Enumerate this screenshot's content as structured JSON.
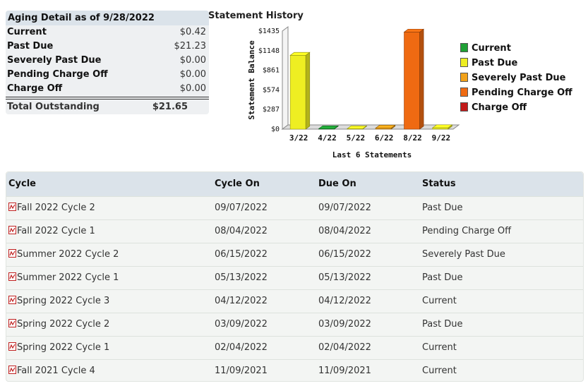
{
  "aging": {
    "title": "Aging Detail as of 9/28/2022",
    "rows": [
      {
        "label": "Current",
        "value": "$0.42"
      },
      {
        "label": "Past Due",
        "value": "$21.23"
      },
      {
        "label": "Severely Past Due",
        "value": "$0.00"
      },
      {
        "label": "Pending Charge Off",
        "value": "$0.00"
      },
      {
        "label": "Charge Off",
        "value": "$0.00"
      }
    ],
    "total_label": "Total Outstanding",
    "total_value": "$21.65"
  },
  "chart_data": {
    "type": "bar",
    "title": "Statement History",
    "xlabel": "Last 6 Statements",
    "ylabel": "Statement Balance",
    "ylim": [
      0,
      1435
    ],
    "yticks": [
      "$0",
      "$287",
      "$574",
      "$861",
      "$1148",
      "$1435"
    ],
    "categories": [
      "3/22",
      "4/22",
      "5/22",
      "6/22",
      "8/22",
      "9/22"
    ],
    "values": [
      1080,
      5,
      5,
      15,
      1420,
      20
    ],
    "bar_status": [
      "Past Due",
      "Current",
      "Past Due",
      "Severely Past Due",
      "Pending Charge Off",
      "Past Due"
    ],
    "legend": [
      {
        "label": "Current",
        "color": "#1fa035"
      },
      {
        "label": "Past Due",
        "color": "#eeee22"
      },
      {
        "label": "Severely Past Due",
        "color": "#f2a21a"
      },
      {
        "label": "Pending Charge Off",
        "color": "#ef6a12"
      },
      {
        "label": "Charge Off",
        "color": "#c21a1a"
      }
    ]
  },
  "table": {
    "headers": {
      "cycle": "Cycle",
      "cycle_on": "Cycle On",
      "due_on": "Due On",
      "status": "Status"
    },
    "rows": [
      {
        "cycle": "Fall 2022 Cycle 2",
        "cycle_on": "09/07/2022",
        "due_on": "09/07/2022",
        "status": "Past Due"
      },
      {
        "cycle": "Fall 2022 Cycle 1",
        "cycle_on": "08/04/2022",
        "due_on": "08/04/2022",
        "status": "Pending Charge Off"
      },
      {
        "cycle": "Summer 2022 Cycle 2",
        "cycle_on": "06/15/2022",
        "due_on": "06/15/2022",
        "status": "Severely Past Due"
      },
      {
        "cycle": "Summer 2022 Cycle 1",
        "cycle_on": "05/13/2022",
        "due_on": "05/13/2022",
        "status": "Past Due"
      },
      {
        "cycle": "Spring 2022 Cycle 3",
        "cycle_on": "04/12/2022",
        "due_on": "04/12/2022",
        "status": "Current"
      },
      {
        "cycle": "Spring 2022 Cycle 2",
        "cycle_on": "03/09/2022",
        "due_on": "03/09/2022",
        "status": "Past Due"
      },
      {
        "cycle": "Spring 2022 Cycle 1",
        "cycle_on": "02/04/2022",
        "due_on": "02/04/2022",
        "status": "Current"
      },
      {
        "cycle": "Fall 2021 Cycle 4",
        "cycle_on": "11/09/2021",
        "due_on": "11/09/2021",
        "status": "Current"
      }
    ]
  },
  "icons": {
    "cycle_document": "pdf-icon"
  }
}
